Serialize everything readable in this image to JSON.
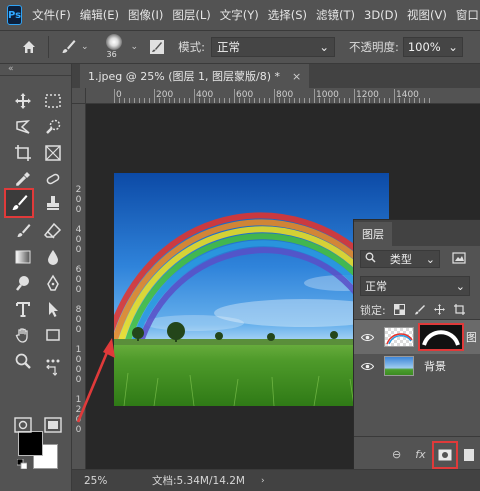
{
  "app": {
    "logo": "Ps"
  },
  "menu": [
    "文件(F)",
    "编辑(E)",
    "图像(I)",
    "图层(L)",
    "文字(Y)",
    "选择(S)",
    "滤镜(T)",
    "3D(D)",
    "视图(V)",
    "窗口"
  ],
  "options": {
    "brush_size": "36",
    "mode_label": "模式:",
    "mode_value": "正常",
    "opacity_label": "不透明度:",
    "opacity_value": "100%"
  },
  "toolbar": {
    "collapse": "«"
  },
  "document": {
    "tab_title": "1.jpeg @ 25% (图层 1, 图层蒙版/8) *",
    "close": "×"
  },
  "ruler": {
    "horizontal": [
      "0",
      "200",
      "400",
      "600",
      "800",
      "1000",
      "1200",
      "1400"
    ],
    "vertical": [
      "2",
      "0",
      "0",
      "4",
      "0",
      "0",
      "6",
      "0",
      "0",
      "8",
      "0",
      "0",
      "1",
      "0",
      "0",
      "0",
      "1",
      "2",
      "0",
      "0"
    ]
  },
  "status": {
    "zoom": "25%",
    "doc_info": "文档:5.34M/14.2M",
    "arrow": "›"
  },
  "layers_panel": {
    "tab": "图层",
    "filter_value": "类型",
    "blend_value": "正常",
    "lock_label": "锁定:",
    "layers": [
      {
        "name": "图",
        "has_mask": true,
        "selected": true
      },
      {
        "name": "背景",
        "has_mask": false,
        "selected": false
      }
    ],
    "bottom": {
      "link": "⊖",
      "fx": "fx"
    }
  },
  "colors": {
    "accent_red": "#e03a3a",
    "panel_bg": "#535353",
    "canvas_bg": "#282828"
  }
}
